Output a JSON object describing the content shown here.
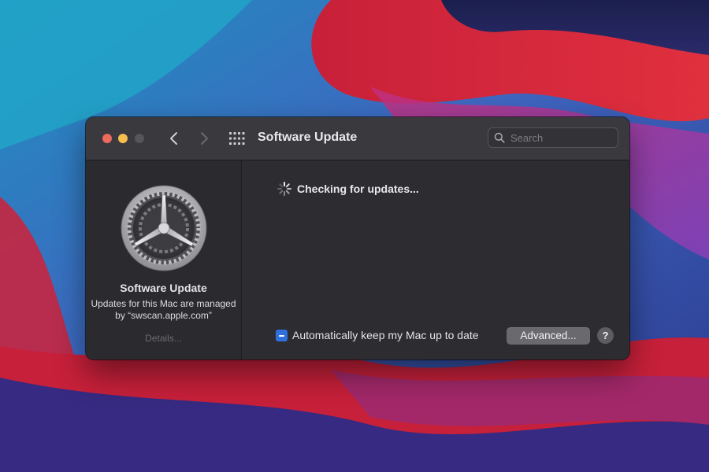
{
  "window": {
    "title": "Software Update",
    "search_placeholder": "Search"
  },
  "toolbar": {
    "buttons": [
      "close",
      "minimize",
      "zoom",
      "back",
      "forward",
      "show-all"
    ]
  },
  "sidebar": {
    "title": "Software Update",
    "description": "Updates for this Mac are managed by “swscan.apple.com”",
    "details_link": "Details..."
  },
  "main": {
    "status": "Checking for updates...",
    "auto_update_label": "Automatically keep my Mac up to date",
    "auto_update_state": "mixed",
    "advanced_label": "Advanced...",
    "help_label": "?"
  },
  "colors": {
    "accent": "#2f6fde",
    "window_bg": "#2d2c31",
    "titlebar_bg": "#3a393e",
    "close": "#ed6a5e",
    "minimize": "#f5bf4f",
    "zoom_disabled": "#56555a"
  },
  "icons": {
    "app": "gear-icon",
    "spinner": "spinner-icon",
    "search": "magnifying-glass-icon",
    "back": "chevron-left-icon",
    "forward": "chevron-right-icon",
    "show_all": "grid-icon"
  }
}
